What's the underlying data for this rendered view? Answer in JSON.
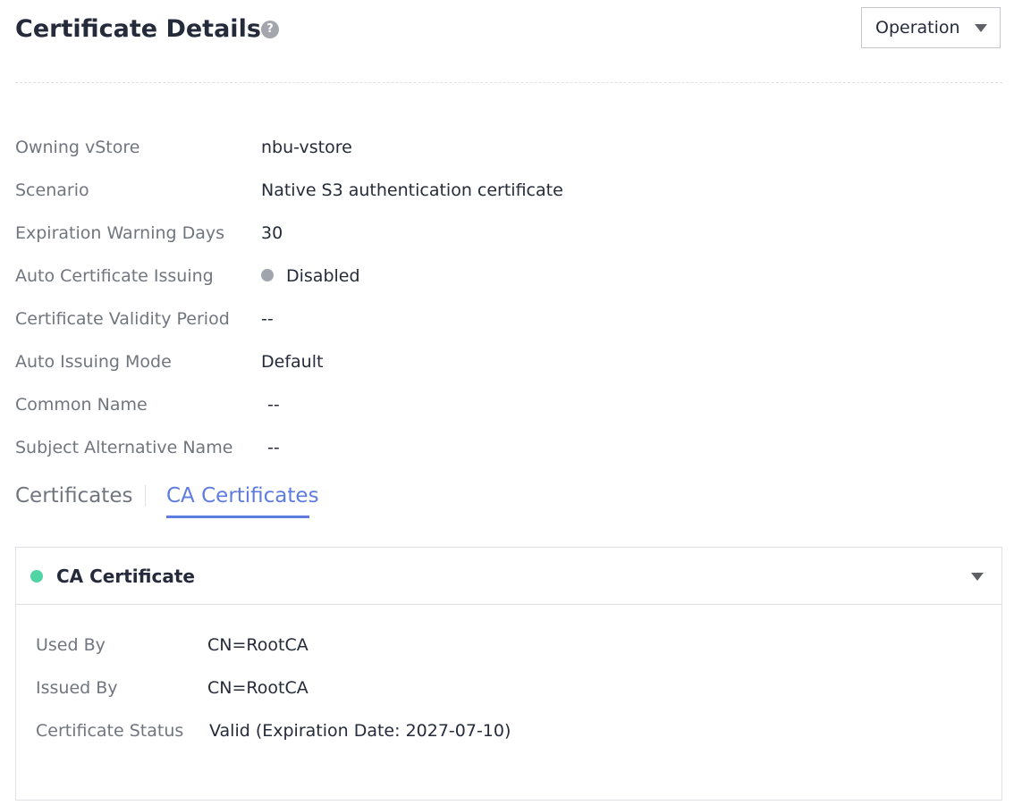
{
  "header": {
    "title": "Certificate Details",
    "help_icon": "question-circle-icon",
    "help_glyph": "?",
    "operation_label": "Operation",
    "operation_icon": "chevron-down-icon"
  },
  "attributes": [
    {
      "label": "Owning vStore",
      "value": "nbu-vstore"
    },
    {
      "label": "Scenario",
      "value": "Native S3 authentication certificate"
    },
    {
      "label": "Expiration Warning Days",
      "value": "30"
    },
    {
      "label": "Auto Certificate Issuing",
      "value": "Disabled",
      "status_color": "#a0a4ad"
    },
    {
      "label": "Certificate Validity Period",
      "value": "--"
    },
    {
      "label": "Auto Issuing Mode",
      "value": "Default"
    },
    {
      "label": "Common Name",
      "value": "--"
    },
    {
      "label": "Subject Alternative Name",
      "value": "--"
    }
  ],
  "tabs": [
    {
      "label": "Certificates",
      "active": false
    },
    {
      "label": "CA Certificates",
      "active": true
    }
  ],
  "ca_panel": {
    "title": "CA Certificate",
    "status_color": "#50d4a4",
    "expanded": true,
    "rows": [
      {
        "label": "Used By",
        "value": "CN=RootCA"
      },
      {
        "label": "Issued By",
        "value": "CN=RootCA"
      },
      {
        "label": "Certificate Status",
        "value": "Valid (Expiration Date: 2027-07-10)"
      }
    ]
  },
  "colors": {
    "accent": "#5e7ce0",
    "text_primary": "#252b3a",
    "text_secondary": "#71757f",
    "border": "#dfe1e6"
  }
}
